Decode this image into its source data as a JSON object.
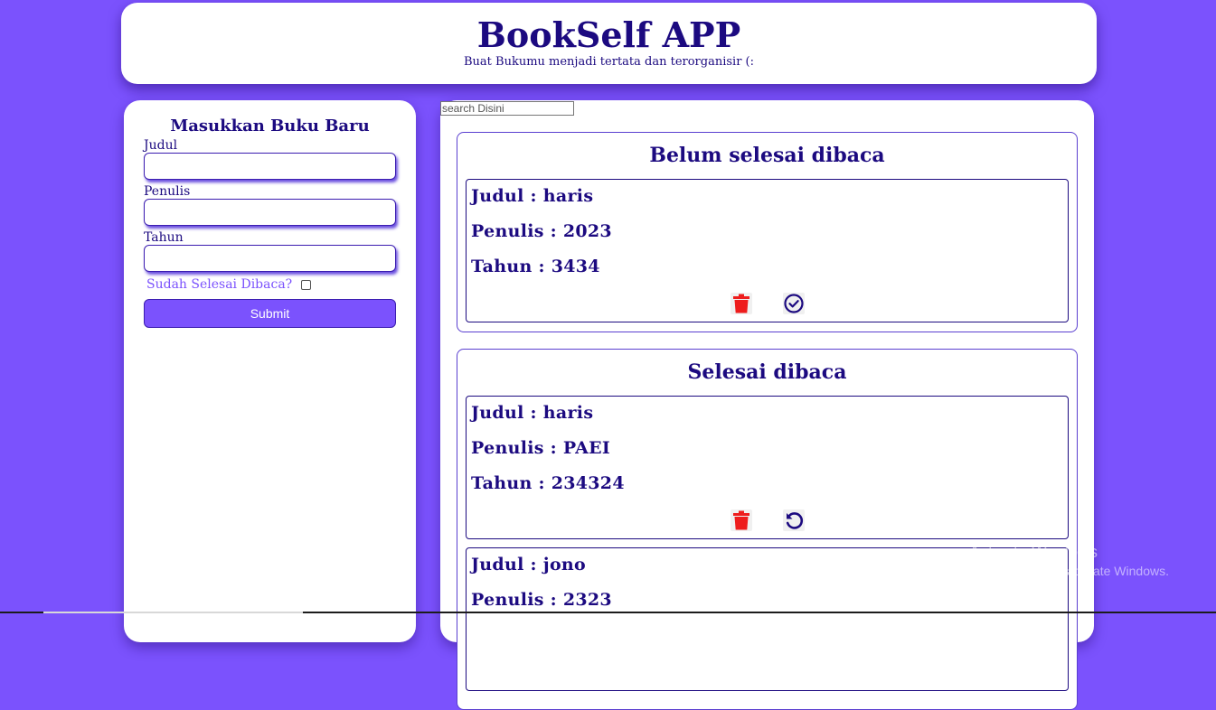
{
  "header": {
    "title": "BookSelf APP",
    "subtitle": "Buat Bukumu menjadi tertata dan terorganisir (:"
  },
  "form": {
    "heading": "Masukkan Buku Baru",
    "judul_label": "Judul",
    "penulis_label": "Penulis",
    "tahun_label": "Tahun",
    "checkbox_label": "Sudah Selesai Dibaca?",
    "submit_label": "Submit"
  },
  "search": {
    "placeholder": "search Disini"
  },
  "unread_shelf": {
    "heading": "Belum selesai dibaca",
    "books": [
      {
        "judul": "Judul : haris",
        "penulis": "Penulis : 2023",
        "tahun": "Tahun : 3434"
      }
    ]
  },
  "read_shelf": {
    "heading": "Selesai dibaca",
    "books": [
      {
        "judul": "Judul : haris",
        "penulis": "Penulis : PAEI",
        "tahun": "Tahun : 234324"
      },
      {
        "judul": "Judul : jono",
        "penulis": "Penulis : 2323",
        "tahun": ""
      }
    ]
  },
  "icons": {
    "delete": "trash-icon",
    "finish": "check-circle-icon",
    "undo": "undo-icon"
  },
  "colors": {
    "background": "#7b52fd",
    "text": "#1c0a80",
    "delete": "#ee1c1c",
    "accent": "#7b52fd"
  },
  "watermark": {
    "line1": "Activate Windows",
    "line2": "Go to Settings to activate Windows."
  }
}
